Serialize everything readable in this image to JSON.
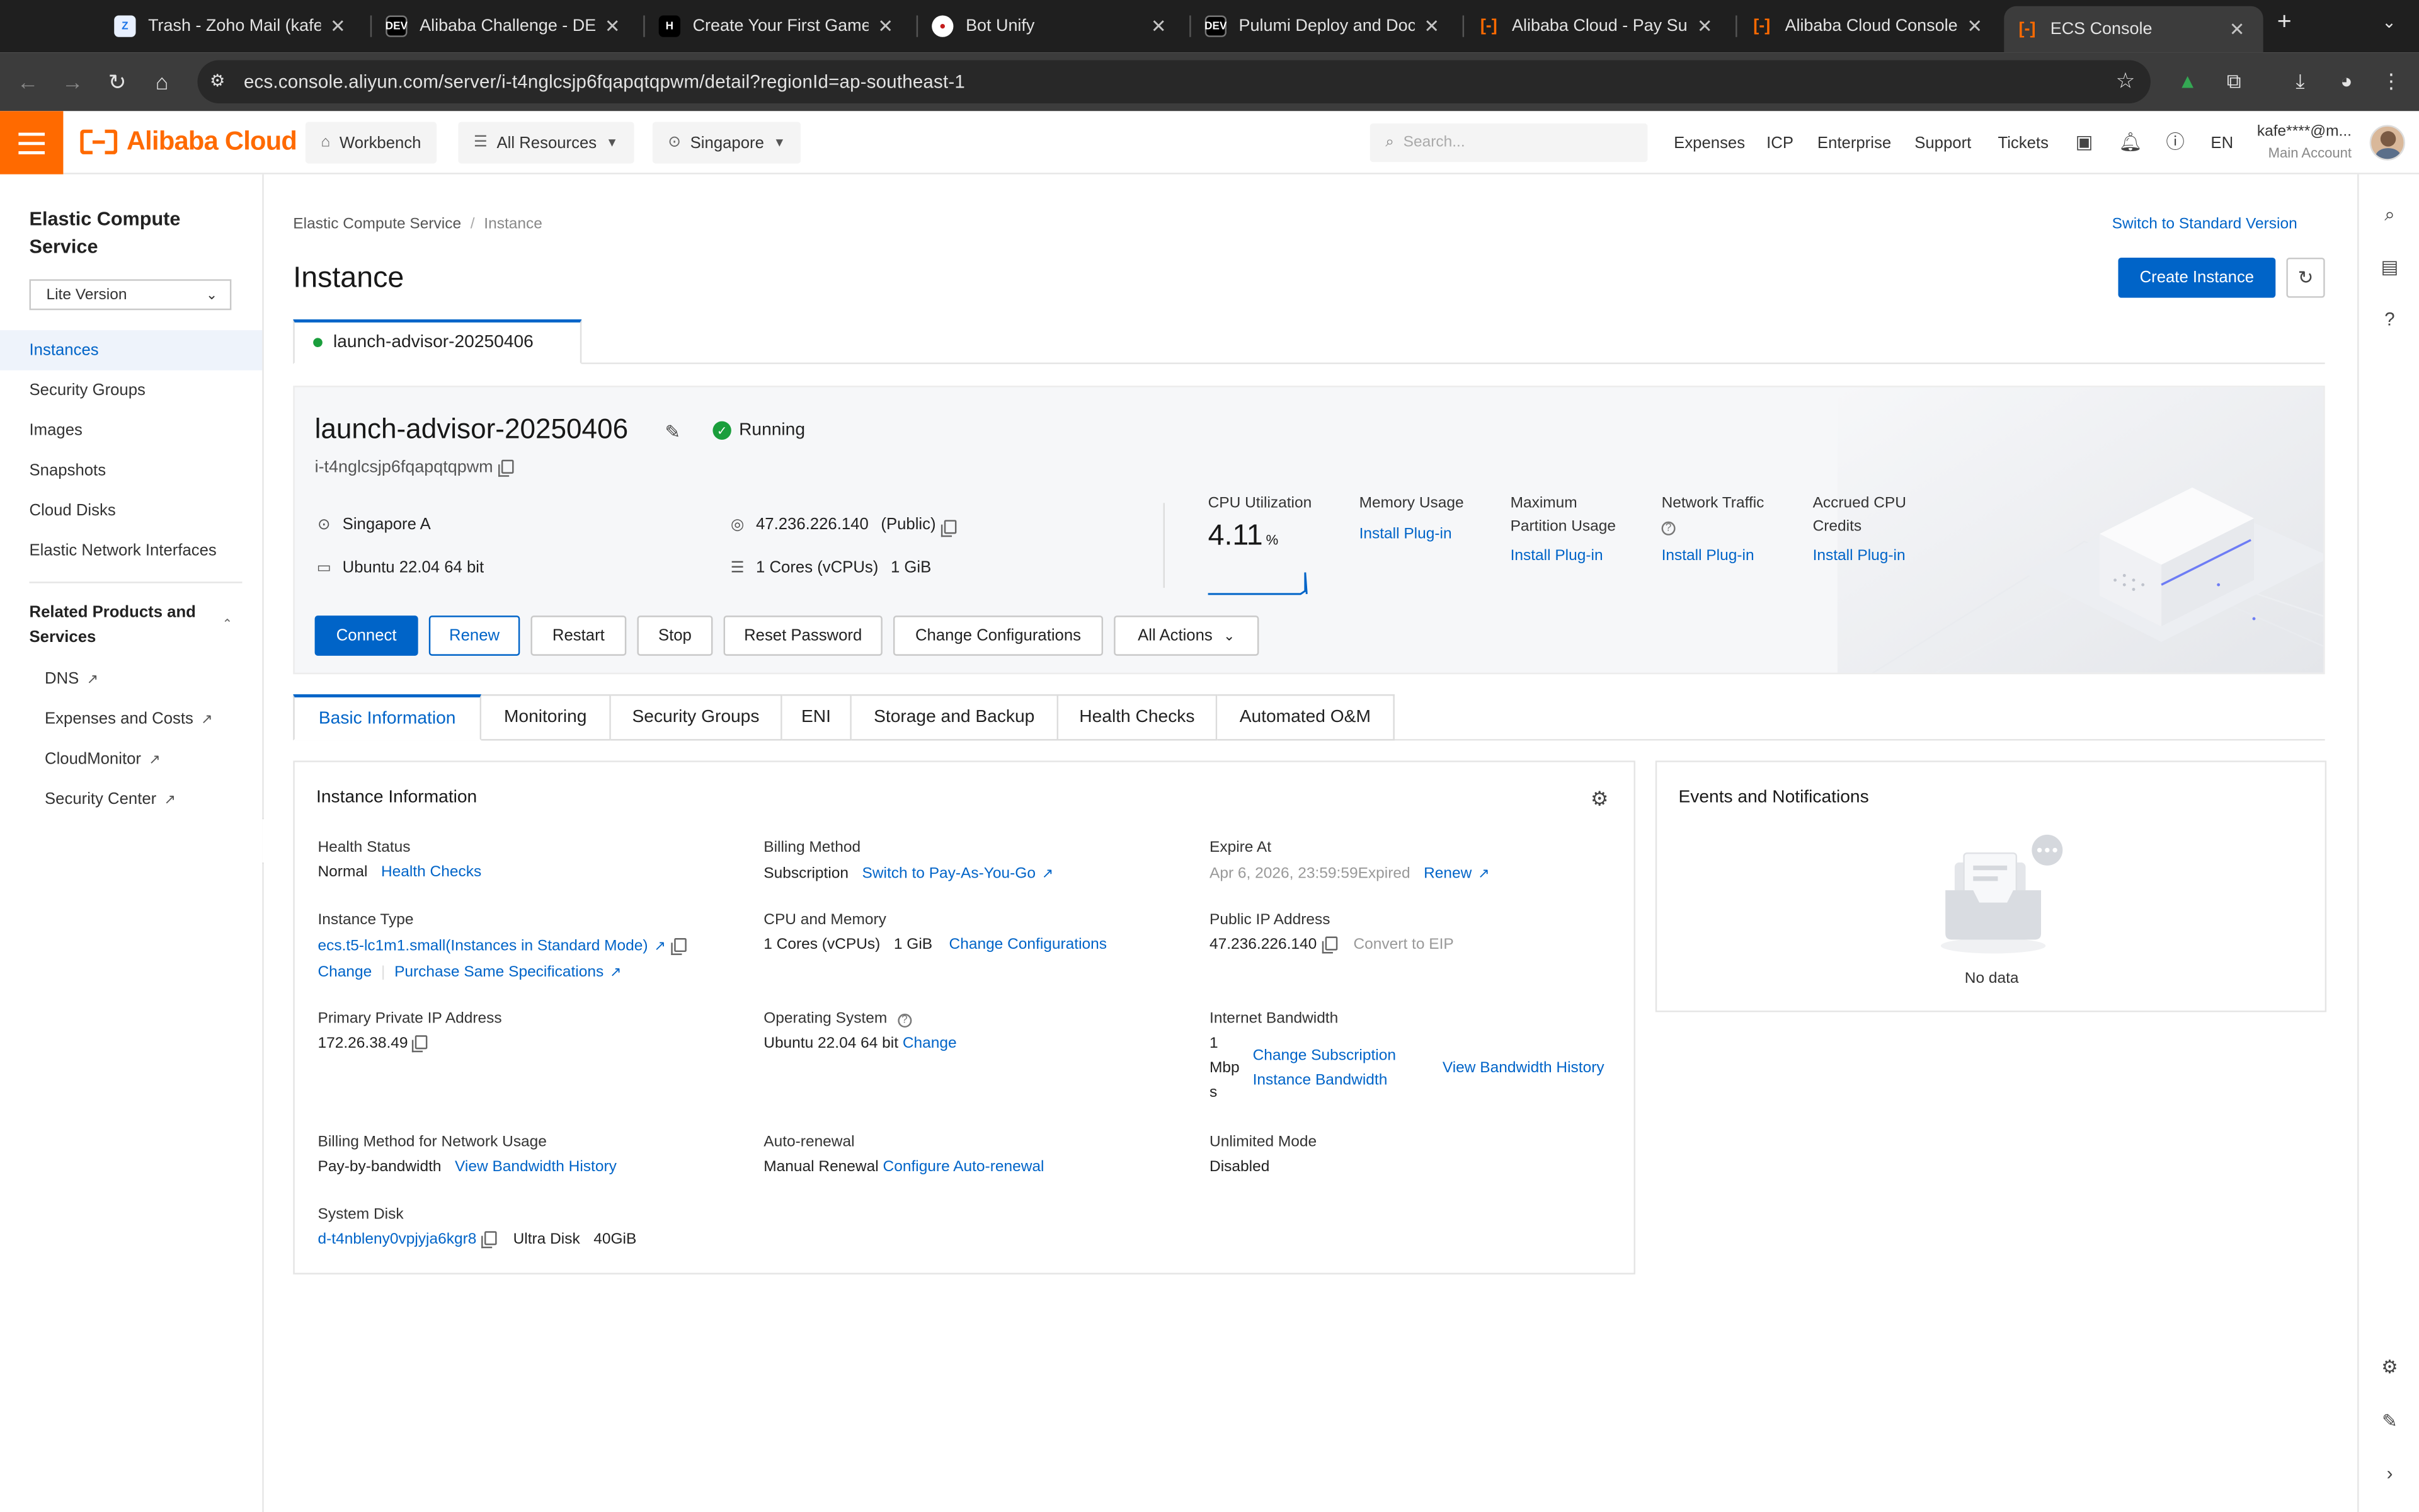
{
  "browser": {
    "tabs": [
      {
        "title": "Trash - Zoho Mail (kafech",
        "icon": "zoho-mail-icon"
      },
      {
        "title": "Alibaba Challenge - DEV C",
        "icon": "dev-icon"
      },
      {
        "title": "Create Your First Game | ",
        "icon": "hashnode-icon"
      },
      {
        "title": "Bot Unify",
        "icon": "bot-unify-icon"
      },
      {
        "title": "Pulumi Deploy and Docum",
        "icon": "dev-icon"
      },
      {
        "title": "Alibaba Cloud - Pay Succe",
        "icon": "alibaba-icon"
      },
      {
        "title": "Alibaba Cloud Console Ho",
        "icon": "alibaba-icon"
      },
      {
        "title": "ECS Console",
        "icon": "alibaba-icon"
      }
    ],
    "url": "ecs.console.aliyun.com/server/i-t4nglcsjp6fqapqtqpwm/detail?regionId=ap-southeast-1"
  },
  "header": {
    "brand": "Alibaba Cloud",
    "workbench": "Workbench",
    "all_resources": "All Resources",
    "region": "Singapore",
    "search_placeholder": "Search...",
    "links": [
      "Expenses",
      "ICP",
      "Enterprise",
      "Support",
      "Tickets"
    ],
    "lang": "EN",
    "account": "kafe****@m...",
    "account_sub": "Main Account"
  },
  "sidebar": {
    "title": "Elastic Compute Service",
    "version": "Lite Version",
    "items": [
      "Instances",
      "Security Groups",
      "Images",
      "Snapshots",
      "Cloud Disks",
      "Elastic Network Interfaces"
    ],
    "related_title": "Related Products and Services",
    "related": [
      "DNS",
      "Expenses and Costs",
      "CloudMonitor",
      "Security Center"
    ]
  },
  "main": {
    "breadcrumb": [
      "Elastic Compute Service",
      "Instance"
    ],
    "switch_version": "Switch to Standard Version",
    "title": "Instance",
    "create_button": "Create Instance",
    "instance_tab": "launch-advisor-20250406",
    "instance": {
      "name": "launch-advisor-20250406",
      "status": "Running",
      "id": "i-t4nglcsjp6fqapqtqpwm",
      "zone": "Singapore A",
      "public_ip": "47.236.226.140",
      "public_ip_label": "(Public)",
      "os": "Ubuntu 22.04 64 bit",
      "cores": "1 Cores (vCPUs)",
      "memory": "1 GiB"
    },
    "metrics": {
      "cpu_label": "CPU Utilization",
      "cpu_value": "4.11",
      "cpu_unit": "%",
      "memory_label": "Memory Usage",
      "partition_label": "Maximum Partition Usage",
      "network_label": "Network Traffic",
      "credits_label": "Accrued CPU Credits",
      "install_plugin": "Install Plug-in"
    },
    "actions": [
      "Connect",
      "Renew",
      "Restart",
      "Stop",
      "Reset Password",
      "Change Configurations",
      "All Actions"
    ],
    "tabs": [
      "Basic Information",
      "Monitoring",
      "Security Groups",
      "ENI",
      "Storage and Backup",
      "Health Checks",
      "Automated O&M"
    ]
  },
  "info": {
    "title": "Instance Information",
    "health_status_label": "Health Status",
    "health_status": "Normal",
    "health_checks_link": "Health Checks",
    "billing_method_label": "Billing Method",
    "billing_method": "Subscription",
    "switch_payg": "Switch to Pay-As-You-Go",
    "expire_label": "Expire At",
    "expire_value": "Apr 6, 2026, 23:59:59",
    "expired": "Expired",
    "renew": "Renew",
    "instance_type_label": "Instance Type",
    "instance_type": "ecs.t5-lc1m1.small(Instances in Standard Mode)",
    "change": "Change",
    "purchase_same": "Purchase Same Specifications",
    "cpu_mem_label": "CPU and Memory",
    "cpu_cores": "1 Cores (vCPUs)",
    "mem": "1 GiB",
    "change_config": "Change Configurations",
    "public_ip_label": "Public IP Address",
    "public_ip": "47.236.226.140",
    "convert_eip": "Convert to EIP",
    "private_ip_label": "Primary Private IP Address",
    "private_ip": "172.26.38.49",
    "os_label": "Operating System",
    "os": "Ubuntu 22.04 64 bit",
    "os_change": "Change",
    "bandwidth_label": "Internet Bandwidth",
    "bandwidth_l1": "1",
    "bandwidth_l2": "Mbp",
    "bandwidth_l3": "s",
    "change_sub_bw_l1": "Change Subscription",
    "change_sub_bw_l2": "Instance Bandwidth",
    "view_bw_history": "View Bandwidth History",
    "net_billing_label": "Billing Method for Network Usage",
    "net_billing": "Pay-by-bandwidth",
    "auto_renew_label": "Auto-renewal",
    "auto_renew": "Manual Renewal",
    "configure_auto_renew": "Configure Auto-renewal",
    "unlimited_label": "Unlimited Mode",
    "unlimited": "Disabled",
    "system_disk_label": "System Disk",
    "system_disk_id": "d-t4nbleny0vpjyja6kgr8",
    "system_disk_type": "Ultra Disk",
    "system_disk_size": "40GiB"
  },
  "events": {
    "title": "Events and Notifications",
    "empty": "No data"
  }
}
